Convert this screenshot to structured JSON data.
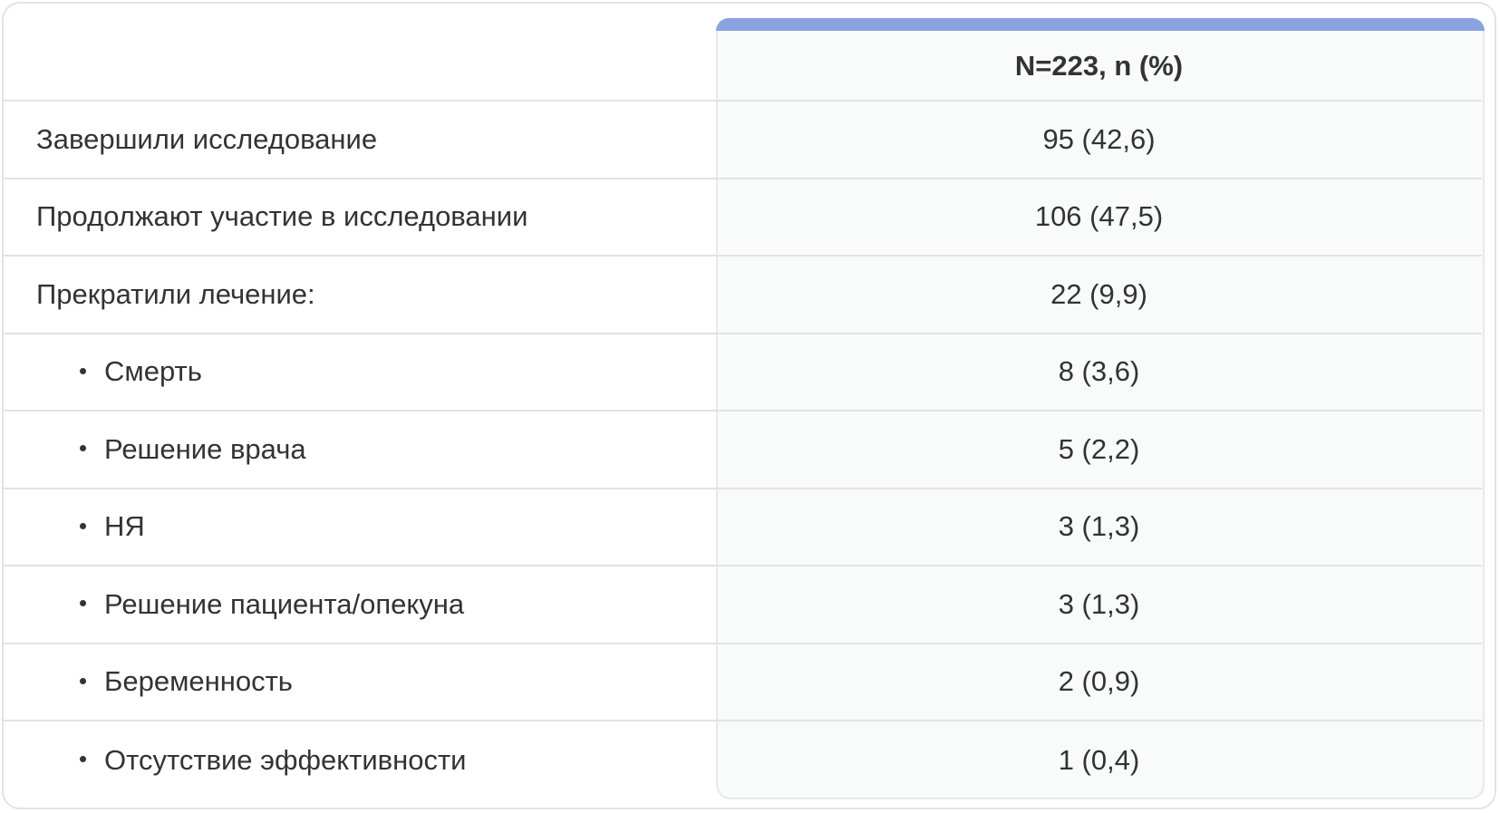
{
  "header": {
    "label": "",
    "value": "N=223, n (%)"
  },
  "rows": [
    {
      "label": "Завершили исследование",
      "value": "95 (42,6)",
      "sub": false
    },
    {
      "label": "Продолжают участие в исследовании",
      "value": "106 (47,5)",
      "sub": false
    },
    {
      "label": "Прекратили лечение:",
      "value": "22 (9,9)",
      "sub": false
    },
    {
      "label": "Смерть",
      "value": "8 (3,6)",
      "sub": true
    },
    {
      "label": "Решение врача",
      "value": "5 (2,2)",
      "sub": true
    },
    {
      "label": "НЯ",
      "value": "3 (1,3)",
      "sub": true
    },
    {
      "label": "Решение пациента/опекуна",
      "value": "3 (1,3)",
      "sub": true
    },
    {
      "label": "Беременность",
      "value": "2 (0,9)",
      "sub": true
    },
    {
      "label": "Отсутствие эффективности",
      "value": "1 (0,4)",
      "sub": true
    }
  ],
  "colors": {
    "accent": "#8aa3e0",
    "panel": "#f9fafa",
    "border": "#e3e3e3",
    "text": "#333333"
  }
}
